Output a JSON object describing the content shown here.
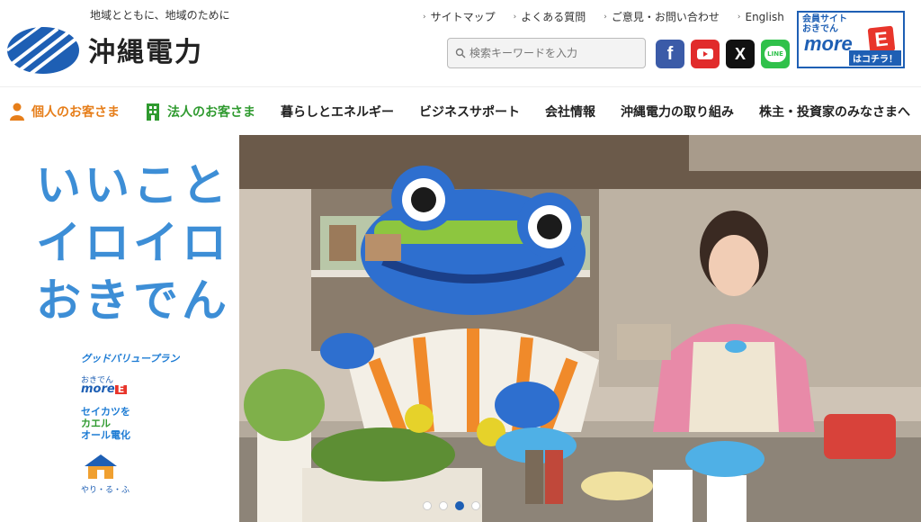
{
  "header": {
    "tagline": "地域とともに、地域のために",
    "company_name": "沖縄電力",
    "util_links": [
      "サイトマップ",
      "よくある質問",
      "ご意見・お問い合わせ",
      "English"
    ],
    "search_placeholder": "検索キーワードを入力",
    "social": [
      {
        "name": "facebook-icon",
        "glyph": "f"
      },
      {
        "name": "youtube-icon",
        "glyph": "▶"
      },
      {
        "name": "x-icon",
        "glyph": "X"
      },
      {
        "name": "line-icon",
        "glyph": "LINE"
      }
    ],
    "member_banner": {
      "top": "会員サイト",
      "sub": "おきでん",
      "logo": "more",
      "e": "E",
      "bottom": "はコチラ！"
    }
  },
  "nav": {
    "personal": "個人のお客さま",
    "corporate": "法人のお客さま",
    "items": [
      "暮らしとエネルギー",
      "ビジネスサポート",
      "会社情報",
      "沖縄電力の取り組み",
      "株主・投資家のみなさまへ"
    ]
  },
  "hero": {
    "catch_lines": [
      "いいこと",
      "イロイロ",
      "おきでん"
    ],
    "badges": {
      "goodvalue": "グッドバリュープラン",
      "moree_small": "おきでん",
      "moree_word": "more",
      "moree_e": "E",
      "kaeru_1": "セイカツを",
      "kaeru_2": "カエル",
      "kaeru_3": "オール電化",
      "yari": "やり・る・ふ"
    },
    "carousel": {
      "total": 4,
      "active": 3
    }
  },
  "colors": {
    "brand_blue": "#1e5fb4",
    "personal_orange": "#e67e1a",
    "corporate_green": "#2f9a2f",
    "catch_blue": "#3d8ed6"
  }
}
